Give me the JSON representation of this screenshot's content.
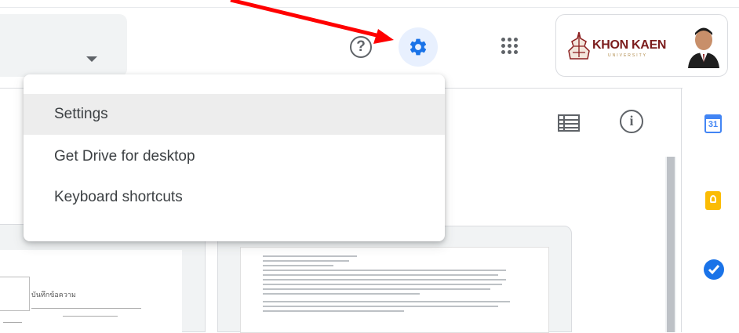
{
  "header": {
    "help_icon": "?",
    "brand": "KHON KAEN",
    "brand_sub": "UNIVERSITY",
    "settings_icon": "gear-icon",
    "apps_icon": "grid-icon",
    "accent_color": "#1a73e8"
  },
  "menu": {
    "items": [
      {
        "label": "Settings",
        "highlighted": true
      },
      {
        "label": "Get Drive for desktop"
      },
      {
        "label": "Keyboard shortcuts"
      }
    ]
  },
  "side_panel": {
    "calendar_number": "31"
  },
  "preview": {
    "doc1_title": "บันทึกข้อความ"
  },
  "annotation": {
    "arrow_color": "#ff0000"
  }
}
